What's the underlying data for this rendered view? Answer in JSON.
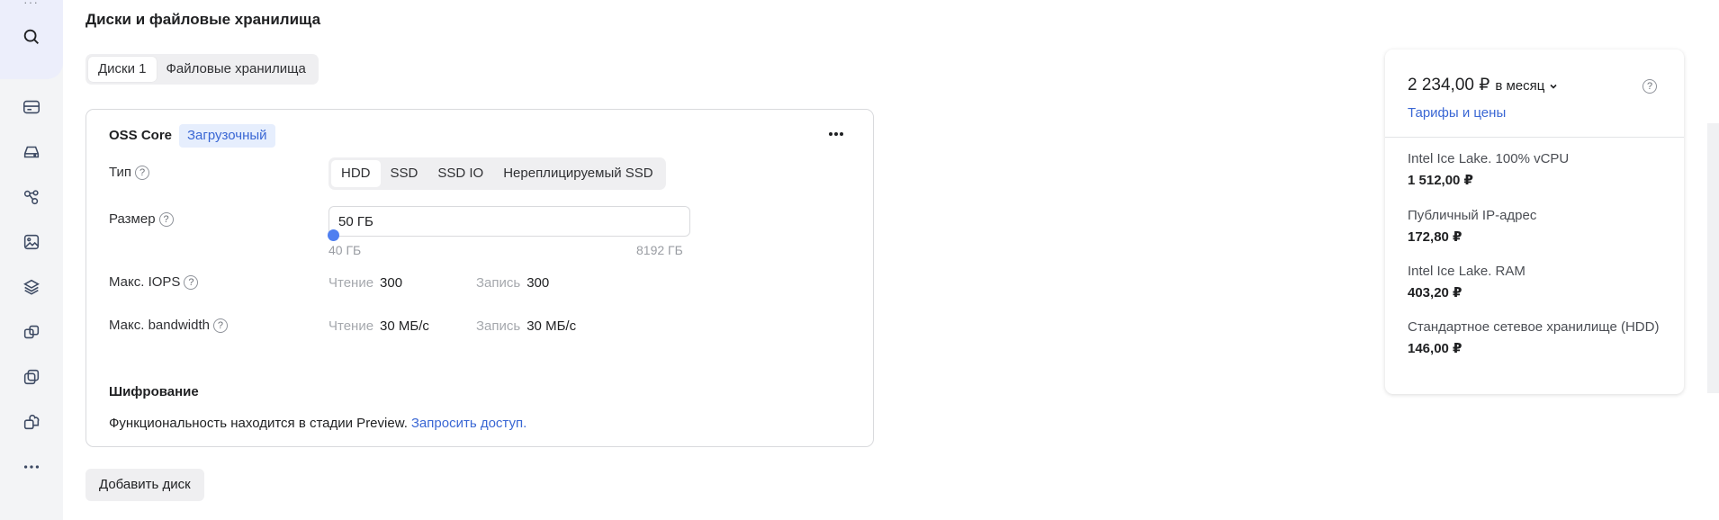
{
  "page": {
    "title": "Диски и файловые хранилища"
  },
  "tabs": [
    {
      "label": "Диски 1",
      "active": true
    },
    {
      "label": "Файловые хранилища",
      "active": false
    }
  ],
  "disk": {
    "name": "OSS Core",
    "badge": "Загрузочный",
    "type_label": "Тип",
    "type_options": [
      "HDD",
      "SSD",
      "SSD IO",
      "Нереплицируемый SSD"
    ],
    "type_selected": "HDD",
    "size_label": "Размер",
    "size_value": "50 ГБ",
    "size_min": "40 ГБ",
    "size_max": "8192 ГБ",
    "iops_label": "Макс. IOPS",
    "iops_read_label": "Чтение",
    "iops_read_value": "300",
    "iops_write_label": "Запись",
    "iops_write_value": "300",
    "bw_label": "Макс. bandwidth",
    "bw_read_label": "Чтение",
    "bw_read_value": "30 МБ/с",
    "bw_write_label": "Запись",
    "bw_write_value": "30 МБ/с",
    "encryption_title": "Шифрование",
    "encryption_text": "Функциональность находится в стадии Preview.",
    "encryption_link": "Запросить доступ."
  },
  "add_disk_label": "Добавить диск",
  "price": {
    "total": "2 234,00 ₽",
    "period": "в месяц",
    "tariffs_link": "Тарифы и цены",
    "items": [
      {
        "name": "Intel Ice Lake. 100% vCPU",
        "value": "1 512,00 ₽"
      },
      {
        "name": "Публичный IP-адрес",
        "value": "172,80 ₽"
      },
      {
        "name": "Intel Ice Lake. RAM",
        "value": "403,20 ₽"
      },
      {
        "name": "Стандартное сетевое хранилище (HDD)",
        "value": "146,00 ₽"
      }
    ]
  },
  "help_symbol": "?",
  "colors": {
    "accent": "#3a67d4",
    "slider": "#4f7ff0",
    "badge_bg": "#e6eefd"
  }
}
